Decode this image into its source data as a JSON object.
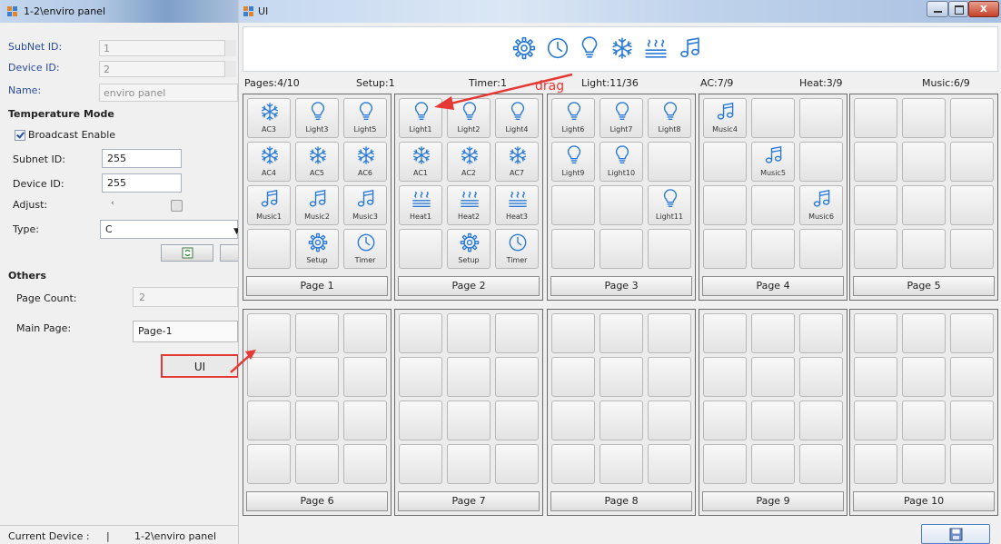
{
  "left_window": {
    "title": "1-2\\enviro panel",
    "subnet_id_label": "SubNet ID:",
    "subnet_id_value": "1",
    "device_id_label": "Device ID:",
    "device_id_value": "2",
    "name_label": "Name:",
    "name_value": "enviro panel",
    "temperature_mode": {
      "heading": "Temperature Mode",
      "broadcast_label": "Broadcast Enable",
      "broadcast_checked": true,
      "subnet_id_label": "Subnet ID:",
      "subnet_id_value": "255",
      "device_id_label": "Device ID:",
      "device_id_value": "255",
      "adjust_label": "Adjust:",
      "type_label": "Type:",
      "type_value": "C"
    },
    "others": {
      "heading": "Others",
      "page_count_label": "Page Count:",
      "page_count_value": "2",
      "main_page_label": "Main Page:",
      "main_page_value": "Page-1"
    },
    "ui_button_label": "UI",
    "status_label": "Current Device :",
    "status_sep": "|",
    "status_value": "1-2\\enviro panel"
  },
  "ui_window": {
    "title": "UI",
    "toolbar_icons": [
      "gear-icon",
      "clock-icon",
      "bulb-icon",
      "snowflake-icon",
      "heat-icon",
      "music-note-icon"
    ],
    "info": {
      "pages": "Pages:4/10",
      "setup": "Setup:1",
      "timer": "Timer:1",
      "light": "Light:11/36",
      "ac": "AC:7/9",
      "heat": "Heat:3/9",
      "music": "Music:6/9"
    },
    "drag_annotation": "drag",
    "annotation_color": "#e53935",
    "icon_color": "#2b7bd6",
    "pages": [
      {
        "label": "Page 1",
        "cells": [
          {
            "icon": "snowflake-icon",
            "label": "AC3"
          },
          {
            "icon": "bulb-icon",
            "label": "Light3"
          },
          {
            "icon": "bulb-icon",
            "label": "Light5"
          },
          {
            "icon": "snowflake-icon",
            "label": "AC4"
          },
          {
            "icon": "snowflake-icon",
            "label": "AC5"
          },
          {
            "icon": "snowflake-icon",
            "label": "AC6"
          },
          {
            "icon": "music-note-icon",
            "label": "Music1"
          },
          {
            "icon": "music-note-icon",
            "label": "Music2"
          },
          {
            "icon": "music-note-icon",
            "label": "Music3"
          },
          {},
          {
            "icon": "gear-icon",
            "label": "Setup"
          },
          {
            "icon": "clock-icon",
            "label": "Timer"
          }
        ]
      },
      {
        "label": "Page 2",
        "cells": [
          {
            "icon": "bulb-icon",
            "label": "Light1"
          },
          {
            "icon": "bulb-icon",
            "label": "Light2"
          },
          {
            "icon": "bulb-icon",
            "label": "Light4"
          },
          {
            "icon": "snowflake-icon",
            "label": "AC1"
          },
          {
            "icon": "snowflake-icon",
            "label": "AC2"
          },
          {
            "icon": "snowflake-icon",
            "label": "AC7"
          },
          {
            "icon": "heat-icon",
            "label": "Heat1"
          },
          {
            "icon": "heat-icon",
            "label": "Heat2"
          },
          {
            "icon": "heat-icon",
            "label": "Heat3"
          },
          {},
          {
            "icon": "gear-icon",
            "label": "Setup"
          },
          {
            "icon": "clock-icon",
            "label": "Timer"
          }
        ]
      },
      {
        "label": "Page 3",
        "cells": [
          {
            "icon": "bulb-icon",
            "label": "Light6"
          },
          {
            "icon": "bulb-icon",
            "label": "Light7"
          },
          {
            "icon": "bulb-icon",
            "label": "Light8"
          },
          {
            "icon": "bulb-icon",
            "label": "Light9"
          },
          {
            "icon": "bulb-icon",
            "label": "Light10"
          },
          {},
          {},
          {},
          {
            "icon": "bulb-icon",
            "label": "Light11"
          },
          {},
          {},
          {}
        ]
      },
      {
        "label": "Page 4",
        "cells": [
          {
            "icon": "music-note-icon",
            "label": "Music4"
          },
          {},
          {},
          {},
          {
            "icon": "music-note-icon",
            "label": "Music5"
          },
          {},
          {},
          {},
          {
            "icon": "music-note-icon",
            "label": "Music6"
          },
          {},
          {},
          {}
        ]
      },
      {
        "label": "Page 5",
        "cells": [
          {},
          {},
          {},
          {},
          {},
          {},
          {},
          {},
          {},
          {},
          {},
          {}
        ]
      },
      {
        "label": "Page 6",
        "cells": [
          {},
          {},
          {},
          {},
          {},
          {},
          {},
          {},
          {},
          {},
          {},
          {}
        ]
      },
      {
        "label": "Page 7",
        "cells": [
          {},
          {},
          {},
          {},
          {},
          {},
          {},
          {},
          {},
          {},
          {},
          {}
        ]
      },
      {
        "label": "Page 8",
        "cells": [
          {},
          {},
          {},
          {},
          {},
          {},
          {},
          {},
          {},
          {},
          {},
          {}
        ]
      },
      {
        "label": "Page 9",
        "cells": [
          {},
          {},
          {},
          {},
          {},
          {},
          {},
          {},
          {},
          {},
          {},
          {}
        ]
      },
      {
        "label": "Page 10",
        "cells": [
          {},
          {},
          {},
          {},
          {},
          {},
          {},
          {},
          {},
          {},
          {},
          {}
        ]
      }
    ]
  }
}
